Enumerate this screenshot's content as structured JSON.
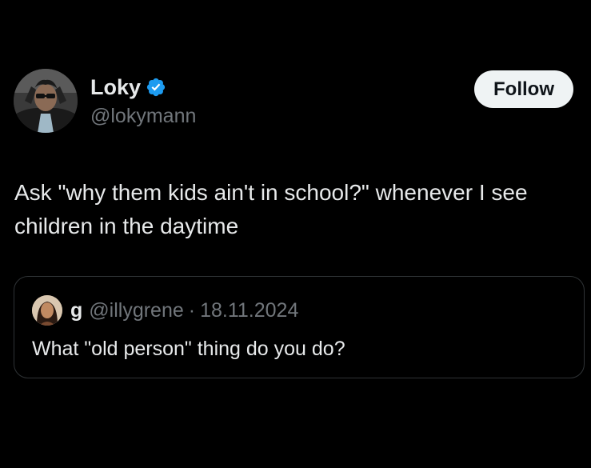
{
  "author": {
    "display_name": "Loky",
    "handle": "@lokymann",
    "verified_icon": "verified-badge-icon",
    "avatar_icon": "profile-avatar"
  },
  "follow_button": {
    "label": "Follow"
  },
  "tweet": {
    "text": "Ask \"why them kids ain't in school?\" whenever I see children in the daytime"
  },
  "quoted_tweet": {
    "display_name": "g",
    "handle": "@illygrene",
    "separator": "·",
    "date": "18.11.2024",
    "text": "What \"old person\" thing do you do?"
  },
  "colors": {
    "background": "#000000",
    "primary_text": "#e7e9ea",
    "secondary_text": "#71767b",
    "verified_blue": "#1d9bf0",
    "border": "#2f3336",
    "follow_bg": "#eff3f4"
  }
}
